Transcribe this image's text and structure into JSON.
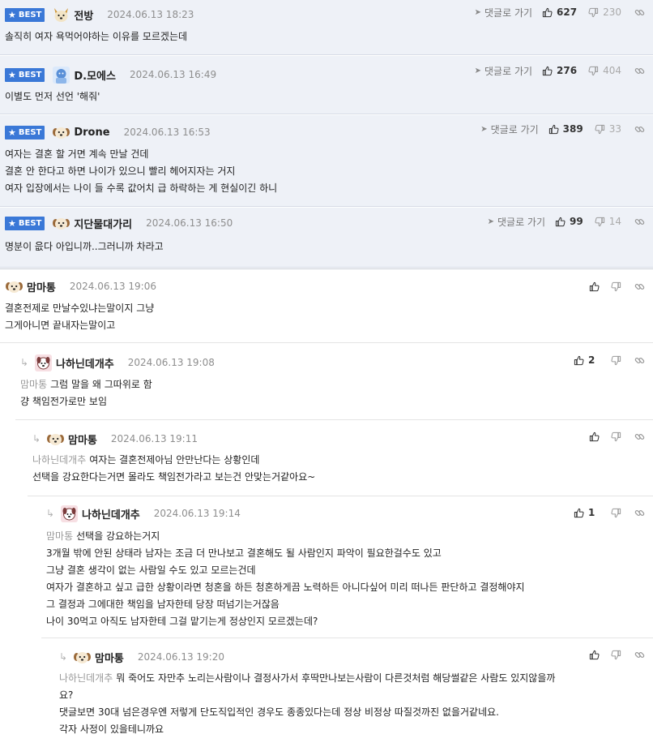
{
  "best_badge_label": "BEST",
  "go_link_label": "댓글로 가기",
  "comments": [
    {
      "best": true,
      "nickname": "전방",
      "avatar": "shiba-dog-face-icon",
      "date": "2024.06.13 18:23",
      "up": "627",
      "down": "230",
      "mention": "",
      "lines": [
        "솔직히 여자 욕먹어야하는 이유를 모르겠는데"
      ]
    },
    {
      "best": true,
      "nickname": "D.모에스",
      "avatar": "blue-character-avatar",
      "date": "2024.06.13 16:49",
      "up": "276",
      "down": "404",
      "mention": "",
      "lines": [
        "이별도 먼저 선언 '해줘'"
      ]
    },
    {
      "best": true,
      "nickname": "Drone",
      "avatar": "puppy-face-icon",
      "date": "2024.06.13 16:53",
      "up": "389",
      "down": "33",
      "mention": "",
      "lines": [
        "여자는 결혼 할 거면 계속 만날 건데",
        "결혼 안 한다고 하면 나이가 있으니 빨리 헤어지자는 거지",
        "여자 입장에서는 나이 들 수록 값어치 급 하락하는 게 현실이긴 하니"
      ]
    },
    {
      "best": true,
      "nickname": "지단물대가리",
      "avatar": "puppy-face-icon",
      "date": "2024.06.13 16:50",
      "up": "99",
      "down": "14",
      "mention": "",
      "lines": [
        "명분이 읎다 아입니까..그러니까 차라고"
      ]
    },
    {
      "best": false,
      "nickname": "맘마통",
      "avatar": "puppy-face-icon",
      "date": "2024.06.13 19:06",
      "up": "",
      "down": "",
      "mention": "",
      "lines": [
        "결혼전제로 만날수있냐는말이지 그냥",
        "그게아니면 끝내자는말이고"
      ]
    },
    {
      "best": false,
      "nickname": "나하닌데개추",
      "avatar": "pink-dog-icon",
      "date": "2024.06.13 19:08",
      "up": "2",
      "down": "",
      "mention": "맘마통",
      "lines": [
        "그럼 말을 왜 그따위로 함",
        "걍 책임전가로만 보임"
      ]
    },
    {
      "best": false,
      "nickname": "맘마통",
      "avatar": "puppy-face-icon",
      "date": "2024.06.13 19:11",
      "up": "",
      "down": "",
      "mention": "나하닌데개추",
      "lines": [
        "여자는 결혼전제아님 안만난다는 상황인데",
        "선택을 강요한다는거면 몰라도 책임전가라고 보는건 안맞는거같아요~"
      ]
    },
    {
      "best": false,
      "nickname": "나하닌데개추",
      "avatar": "pink-dog-icon",
      "date": "2024.06.13 19:14",
      "up": "1",
      "down": "",
      "mention": "맘마통",
      "lines": [
        "선택을 강요하는거지",
        "3개월 밖에 안된 상태라 남자는 조금 더 만나보고 결혼해도 될 사람인지 파악이 필요한걸수도 있고",
        "그냥 결혼 생각이 없는 사람일 수도 있고 모르는건데",
        "여자가 결혼하고 싶고 급한 상황이라면 청혼을 하든 청혼하게끔 노력하든 아니다싶어 미리 떠나든 판단하고 결정해야지",
        "그 결정과 그에대한 책임을 남자한테 당장 떠넘기는거잖음",
        "나이 30먹고 아직도 남자한테 그걸 맡기는게 정상인지 모르겠는데?"
      ]
    },
    {
      "best": false,
      "nickname": "맘마통",
      "avatar": "puppy-face-icon",
      "date": "2024.06.13 19:20",
      "up": "",
      "down": "",
      "mention": "나하닌데개추",
      "lines": [
        "뭐 죽어도 자만추 노리는사람이나 결정사가서 후딱만나보는사람이 다른것처럼 해당썰같은 사람도 있지않을까",
        "요?",
        "댓글보면 30대 넘은경우엔 저렇게 단도직입적인 경우도 종종있다는데 정상 비정상 따질것까진 없을거같네요.",
        "각자 사정이 있을테니까요"
      ]
    }
  ]
}
